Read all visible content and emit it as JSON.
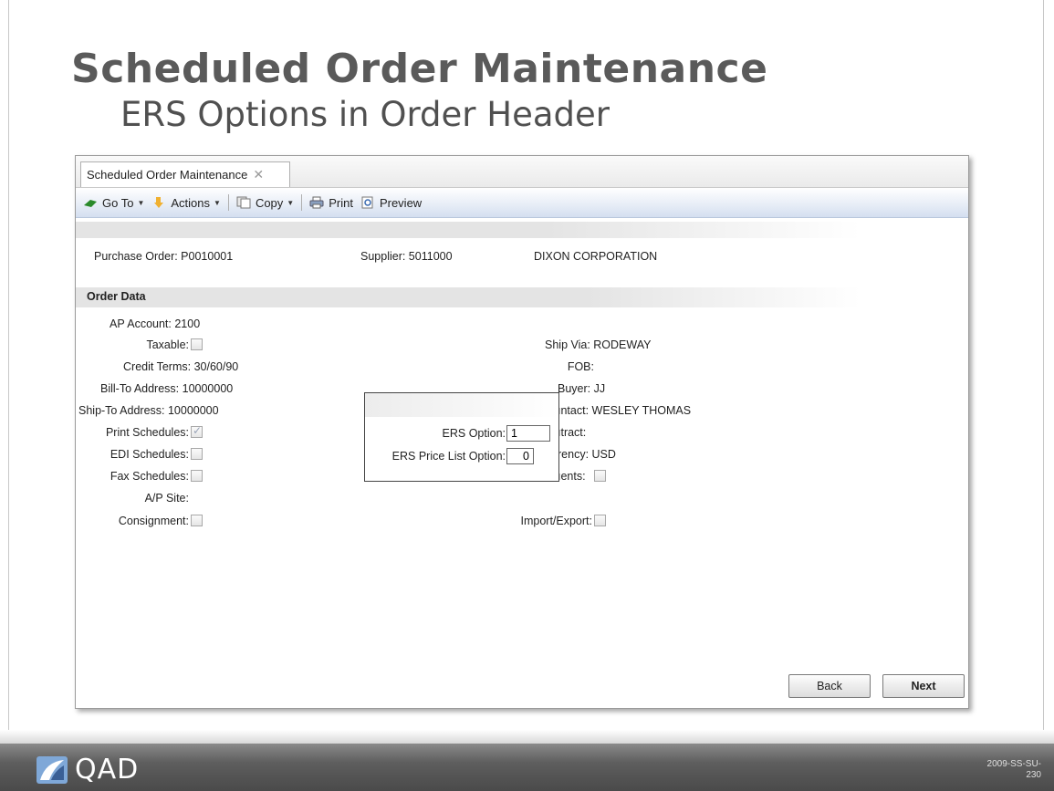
{
  "slide": {
    "title": "Scheduled Order Maintenance",
    "subtitle": "ERS Options in Order Header",
    "footer_code_1": "2009-SS-SU-",
    "footer_code_2": "230",
    "logo_text": "QAD"
  },
  "window": {
    "tab_label": "Scheduled Order Maintenance",
    "tab_close": "✕",
    "toolbar": {
      "goto": "Go To",
      "actions": "Actions",
      "copy": "Copy",
      "print": "Print",
      "preview": "Preview"
    }
  },
  "header": {
    "purchase_order": "Purchase Order: P0010001",
    "supplier": "Supplier: 5011000",
    "supplier_name": "DIXON CORPORATION"
  },
  "order_data": {
    "section_title": "Order Data",
    "left": {
      "ap_account": "AP Account: 2100",
      "taxable": "Taxable:",
      "credit_terms": "Credit Terms: 30/60/90",
      "bill_to": "Bill-To Address: 10000000",
      "ship_to": "Ship-To Address: 10000000",
      "print_schedules": "Print Schedules:",
      "edi_schedules": "EDI Schedules:",
      "fax_schedules": "Fax Schedules:",
      "ap_site": "A/P Site:",
      "consignment": "Consignment:"
    },
    "right": {
      "ship_via": "Ship Via: RODEWAY",
      "fob": "FOB:",
      "buyer": "Buyer: JJ",
      "contact": "ıntact: WESLEY THOMAS",
      "contract": "ıtract:",
      "currency": "rency: USD",
      "comments": "ıents:",
      "import_export": "Import/Export:"
    },
    "print_schedules_checked": true
  },
  "popup": {
    "ers_option_label": "ERS Option:",
    "ers_option_value": "1",
    "ers_price_list_label": "ERS Price List Option:",
    "ers_price_list_value": "0"
  },
  "buttons": {
    "back": "Back",
    "next": "Next"
  },
  "colors": {
    "title": "#5a5a5a",
    "footer": "#4a4a4a",
    "toolbar": "#d4dff0"
  }
}
